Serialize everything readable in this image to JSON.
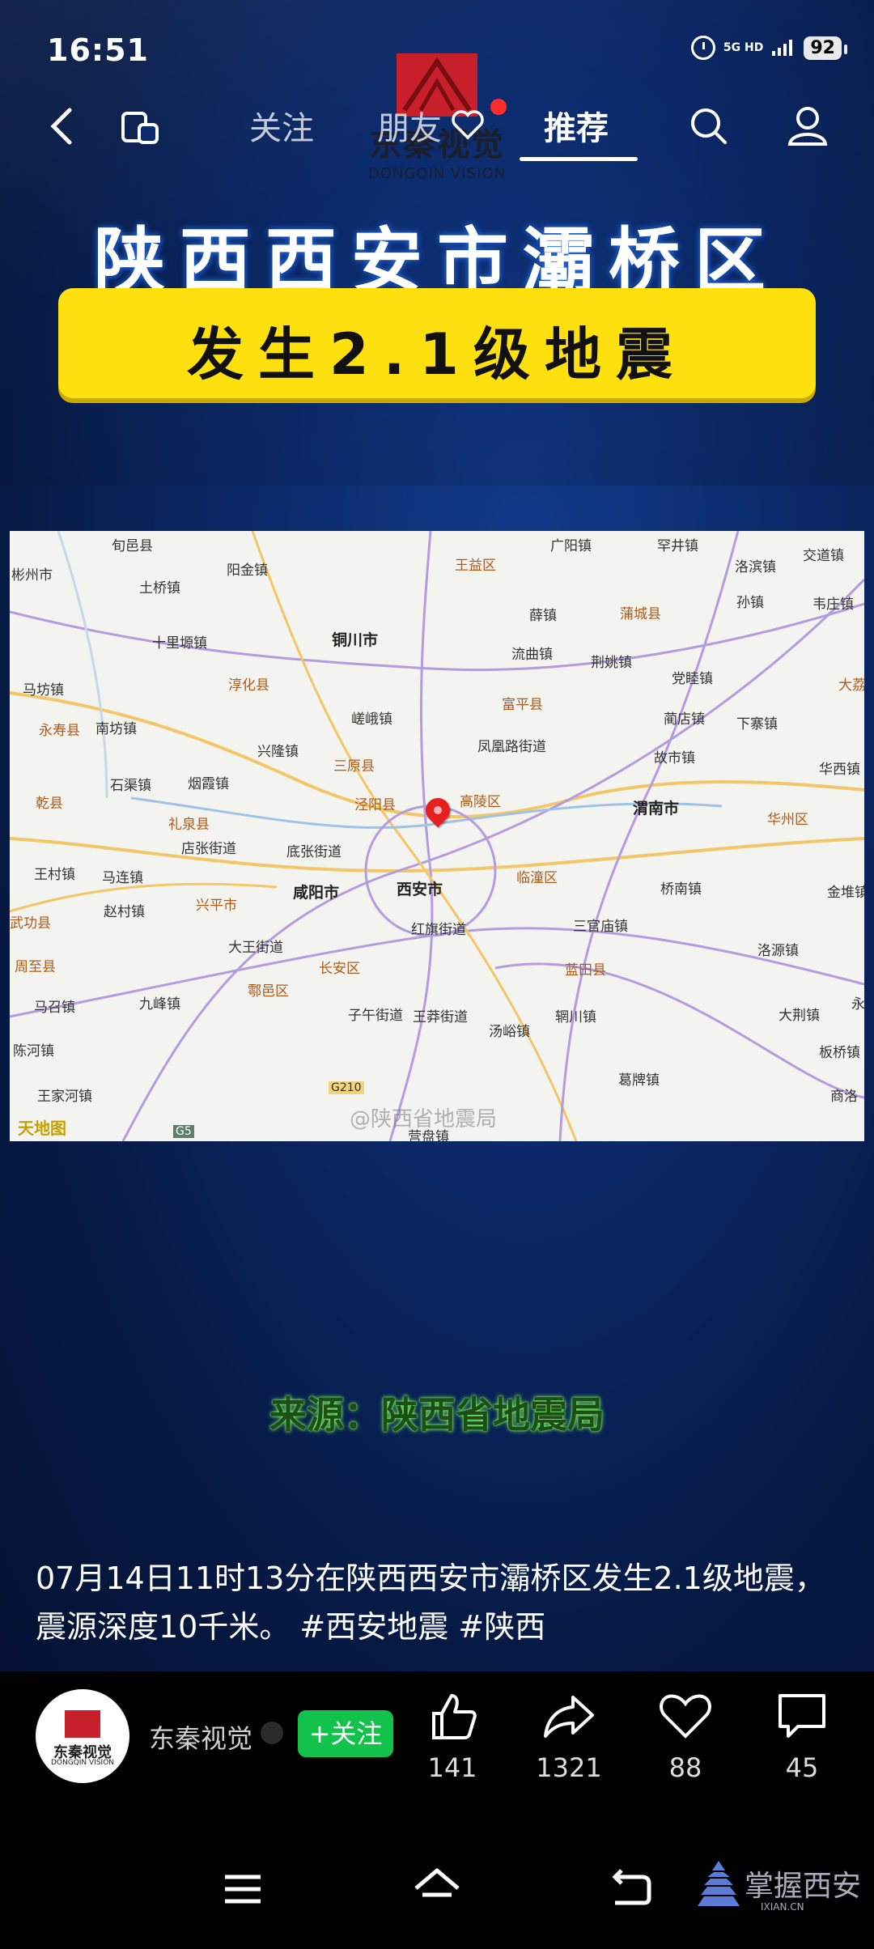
{
  "status_bar": {
    "time": "16:51",
    "network": "5G HD",
    "battery": "92"
  },
  "top_nav": {
    "tabs": [
      "关注",
      "朋友",
      "推荐"
    ],
    "active_tab": "推荐"
  },
  "brand_overlay": {
    "name": "东秦视觉",
    "name_en": "DONGQIN VISION"
  },
  "video": {
    "headline": "陕西西安市灞桥区",
    "banner": "发生2.1级地震",
    "source_text": "来源：陕西省地震局"
  },
  "map": {
    "watermark": "@陕西省地震局",
    "provider": "天地图",
    "labels": {
      "l1": "旬邑县",
      "l2": "彬州市",
      "l3": "广阳镇",
      "l4": "罕井镇",
      "l5": "交道镇",
      "l6": "土桥镇",
      "l7": "阳金镇",
      "l8": "王益区",
      "l9": "洛滨镇",
      "l10": "十里塬镇",
      "l11": "铜川市",
      "l12": "薛镇",
      "l13": "蒲城县",
      "l14": "孙镇",
      "l15": "韦庄镇",
      "l16": "流曲镇",
      "l17": "荆姚镇",
      "l18": "淳化县",
      "l19": "马坊镇",
      "l20": "党睦镇",
      "l21": "大荔",
      "l22": "永寿县",
      "l23": "南坊镇",
      "l24": "嵯峨镇",
      "l25": "富平县",
      "l26": "蔺店镇",
      "l27": "下寨镇",
      "l28": "兴隆镇",
      "l29": "凤凰路街道",
      "l30": "三原县",
      "l31": "故市镇",
      "l32": "华西镇",
      "l33": "石渠镇",
      "l34": "烟霞镇",
      "l35": "乾县",
      "l36": "泾阳县",
      "l37": "高陵区",
      "l38": "渭南市",
      "l39": "礼泉县",
      "l40": "华州区",
      "l41": "店张街道",
      "l42": "底张街道",
      "l43": "王村镇",
      "l44": "马连镇",
      "l45": "临潼区",
      "l46": "桥南镇",
      "l47": "金堆镇",
      "l48": "兴平市",
      "l49": "咸阳市",
      "l50": "西安市",
      "l51": "赵村镇",
      "l52": "武功县",
      "l53": "红旗街道",
      "l54": "三官庙镇",
      "l55": "大王街道",
      "l56": "洛源镇",
      "l57": "周至县",
      "l58": "长安区",
      "l59": "蓝田县",
      "l60": "鄠邑区",
      "l61": "马召镇",
      "l62": "九峰镇",
      "l63": "子午街道",
      "l64": "王莽街道",
      "l65": "汤峪镇",
      "l66": "大荆镇",
      "l67": "辋川镇",
      "l68": "永",
      "l69": "板桥镇",
      "l70": "陈河镇",
      "l71": "葛牌镇",
      "l72": "王家河镇",
      "l73": "商洛",
      "l74": "营盘镇",
      "l75": "G210",
      "l76": "G5"
    }
  },
  "caption": "07月14日11时13分在陕西西安市灞桥区发生2.1级地震，震源深度10千米。 #西安地震 #陕西",
  "author": {
    "name": "东秦视觉",
    "avatar_name": "东秦视觉",
    "avatar_en": "DONGQIN VISION",
    "follow_label": "+关注"
  },
  "actions": {
    "like": "141",
    "share": "1321",
    "favorite": "88",
    "comment": "45"
  },
  "bottom_watermark": {
    "text": "掌握西安",
    "url": "IXIAN.CN"
  }
}
